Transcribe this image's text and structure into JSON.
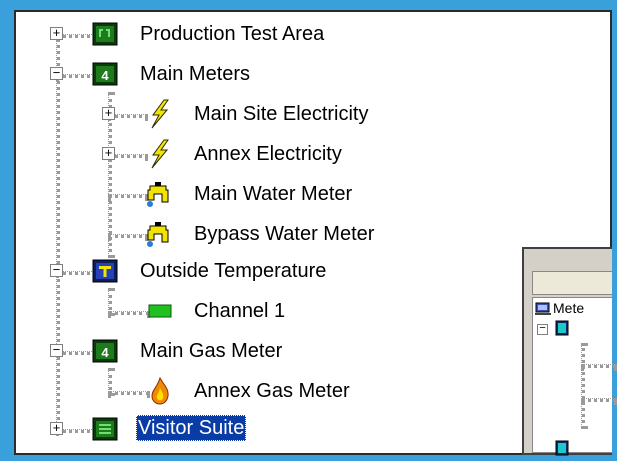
{
  "tree": {
    "items": [
      {
        "label": "Production Test Area",
        "expander": "+",
        "icon": "meter-green-icon"
      },
      {
        "label": "Main Meters",
        "expander": "−",
        "icon": "meter-digit-icon"
      },
      {
        "label": "Main Site Electricity",
        "expander": "+",
        "icon": "electricity-bolt-icon"
      },
      {
        "label": "Annex Electricity",
        "expander": "+",
        "icon": "electricity-bolt-icon"
      },
      {
        "label": "Main Water Meter",
        "expander": "",
        "icon": "water-tap-icon"
      },
      {
        "label": "Bypass Water Meter",
        "expander": "",
        "icon": "water-tap-icon"
      },
      {
        "label": "Outside Temperature",
        "expander": "−",
        "icon": "temperature-meter-icon"
      },
      {
        "label": "Channel 1",
        "expander": "",
        "icon": "channel-green-icon"
      },
      {
        "label": "Main Gas Meter",
        "expander": "−",
        "icon": "meter-digit-icon"
      },
      {
        "label": "Annex Gas Meter",
        "expander": "",
        "icon": "gas-flame-icon"
      },
      {
        "label": "Visitor Suite",
        "expander": "+",
        "icon": "meter-green-icon",
        "selected": true
      }
    ]
  },
  "overlay_window": {
    "list_item_label": "Mete"
  },
  "colors": {
    "background": "#3aa0dc",
    "selection": "#0a3ca8"
  }
}
